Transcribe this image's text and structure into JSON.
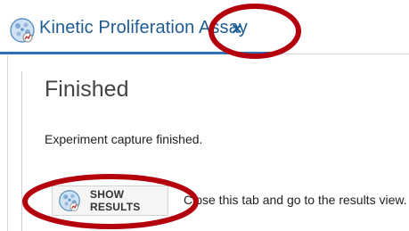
{
  "tab": {
    "title": "Kinetic Proliferation Assay",
    "close_glyph": "×",
    "icon": "cell-assay-icon"
  },
  "panel": {
    "heading": "Finished",
    "message": "Experiment capture finished.",
    "show_results_label": "SHOW RESULTS",
    "show_results_icon": "cell-assay-icon",
    "hint": "Close this tab and go to the results view."
  },
  "colors": {
    "accent": "#2f73b6",
    "tab_text": "#1f5c92",
    "annotation": "#b3000c"
  }
}
